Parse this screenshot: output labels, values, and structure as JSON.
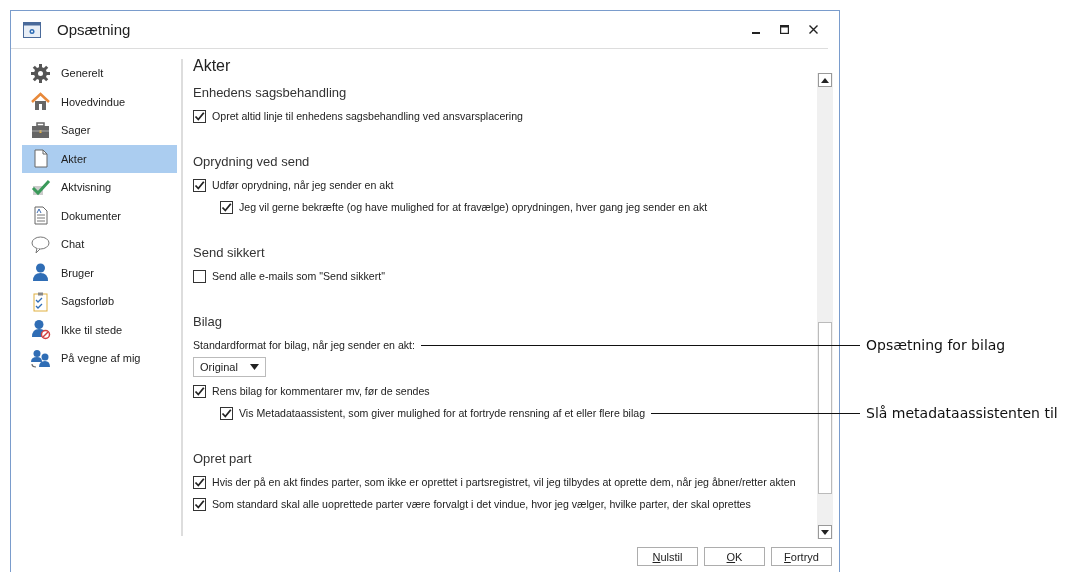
{
  "window": {
    "title": "Opsætning"
  },
  "sidebar": {
    "items": [
      {
        "label": "Generelt",
        "selected": false
      },
      {
        "label": "Hovedvindue",
        "selected": false
      },
      {
        "label": "Sager",
        "selected": false
      },
      {
        "label": "Akter",
        "selected": true
      },
      {
        "label": "Aktvisning",
        "selected": false
      },
      {
        "label": "Dokumenter",
        "selected": false
      },
      {
        "label": "Chat",
        "selected": false
      },
      {
        "label": "Bruger",
        "selected": false
      },
      {
        "label": "Sagsforløb",
        "selected": false
      },
      {
        "label": "Ikke til stede",
        "selected": false
      },
      {
        "label": "På vegne af mig",
        "selected": false
      }
    ]
  },
  "content": {
    "title": "Akter",
    "sections": [
      {
        "heading": "Enhedens sagsbehandling",
        "items": [
          {
            "kind": "checkbox",
            "label": "Opret altid linje til enhedens sagsbehandling ved ansvarsplacering",
            "checked": true
          }
        ]
      },
      {
        "heading": "Oprydning ved send",
        "items": [
          {
            "kind": "checkbox",
            "label": "Udfør oprydning, når jeg sender en akt",
            "checked": true,
            "children": [
              {
                "kind": "checkbox",
                "label": "Jeg vil gerne bekræfte (og have mulighed for at fravælge) oprydningen, hver gang jeg sender en akt",
                "checked": true
              }
            ]
          }
        ]
      },
      {
        "heading": "Send sikkert",
        "items": [
          {
            "kind": "checkbox",
            "label": "Send alle e-mails som \"Send sikkert\"",
            "checked": false
          }
        ]
      },
      {
        "heading": "Bilag",
        "items": [
          {
            "kind": "label",
            "label": "Standardformat for bilag, når jeg sender en akt:"
          },
          {
            "kind": "dropdown",
            "value": "Original"
          },
          {
            "kind": "checkbox",
            "label": "Rens bilag for kommentarer mv, før de sendes",
            "checked": true,
            "children": [
              {
                "kind": "checkbox",
                "label": "Vis Metadataassistent, som giver mulighed for at fortryde rensning af et eller flere bilag",
                "checked": true
              }
            ]
          }
        ]
      },
      {
        "heading": "Opret part",
        "items": [
          {
            "kind": "checkbox",
            "label": "Hvis der på en akt findes parter, som ikke er oprettet i partsregistret, vil jeg tilbydes at oprette dem, når jeg åbner/retter akten",
            "checked": true
          },
          {
            "kind": "checkbox",
            "label": "Som standard skal alle uoprettede parter være forvalgt i det vindue, hvor jeg vælger, hvilke parter, der skal oprettes",
            "checked": true
          }
        ]
      }
    ]
  },
  "buttons": [
    "Nulstil",
    "OK",
    "Fortryd"
  ],
  "callouts": [
    {
      "text": "Opsætning for bilag"
    },
    {
      "text": "Slå metadataassistenten til"
    }
  ]
}
